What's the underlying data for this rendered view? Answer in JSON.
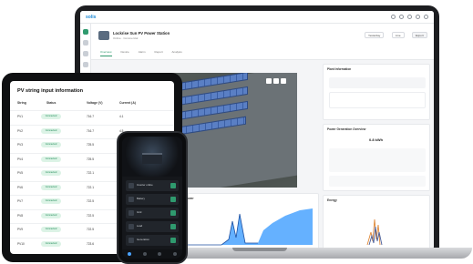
{
  "laptop": {
    "brand": "solis",
    "site": {
      "name": "Lockrise Sun PV Power Station",
      "meta": "Online · Commercial"
    },
    "header_controls": [
      "Yesterday",
      "Live",
      "Export"
    ],
    "tabs": [
      {
        "label": "Overview",
        "active": true
      },
      {
        "label": "Device",
        "active": false
      },
      {
        "label": "Alarm",
        "active": false
      },
      {
        "label": "Report",
        "active": false
      },
      {
        "label": "Analysis",
        "active": false
      }
    ],
    "map": {
      "label": "Plant Layout"
    },
    "panels": {
      "plant_info": {
        "title": "Plant Information"
      },
      "power_summary": {
        "title": "Power Generation Overview",
        "value": "0.8 kWh"
      },
      "chart_left": {
        "title": "Power"
      },
      "chart_right": {
        "title": "Energy"
      }
    },
    "colors": {
      "accent": "#2f9a6e",
      "chart_blue": "#4aa3ff"
    }
  },
  "tablet": {
    "title": "PV string input information",
    "columns": [
      "String",
      "Status",
      "Voltage (V)",
      "Current (A)"
    ],
    "rows": [
      {
        "string": "PV1",
        "status": "Connected",
        "voltage": "716.7",
        "current": "4.1"
      },
      {
        "string": "PV2",
        "status": "Connected",
        "voltage": "716.7",
        "current": "4.5"
      },
      {
        "string": "PV3",
        "status": "Connected",
        "voltage": "725.5",
        "current": "4"
      },
      {
        "string": "PV4",
        "status": "Connected",
        "voltage": "725.5",
        "current": "4"
      },
      {
        "string": "PV5",
        "status": "Connected",
        "voltage": "722.1",
        "current": "4"
      },
      {
        "string": "PV6",
        "status": "Connected",
        "voltage": "722.1",
        "current": "4"
      },
      {
        "string": "PV7",
        "status": "Connected",
        "voltage": "722.5",
        "current": "4"
      },
      {
        "string": "PV8",
        "status": "Connected",
        "voltage": "722.5",
        "current": "4"
      },
      {
        "string": "PV9",
        "status": "Connected",
        "voltage": "722.5",
        "current": "4"
      },
      {
        "string": "PV10",
        "status": "Connected",
        "voltage": "723.6",
        "current": "4"
      }
    ]
  },
  "phone": {
    "cards": [
      {
        "label": "Inverter online"
      },
      {
        "label": "Battery"
      },
      {
        "label": "Grid"
      },
      {
        "label": "Load"
      },
      {
        "label": "Generation"
      }
    ]
  }
}
